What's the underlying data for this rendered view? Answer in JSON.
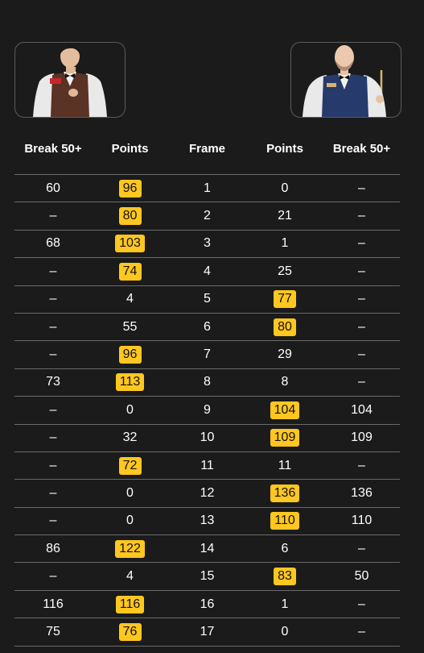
{
  "players": {
    "left": {
      "avatar": "player-left-photo",
      "logo_text": ""
    },
    "right": {
      "avatar": "player-right-photo"
    }
  },
  "headers": {
    "left_break": "Break 50+",
    "left_points": "Points",
    "frame": "Frame",
    "right_points": "Points",
    "right_break": "Break 50+"
  },
  "colors": {
    "background": "#1b1b1b",
    "winner_highlight": "#ffc71f",
    "divider": "#6a6a6a"
  },
  "frames": [
    {
      "left_break": "60",
      "left_points": "96",
      "frame": "1",
      "right_points": "0",
      "right_break": "–",
      "winner": "left"
    },
    {
      "left_break": "–",
      "left_points": "80",
      "frame": "2",
      "right_points": "21",
      "right_break": "–",
      "winner": "left"
    },
    {
      "left_break": "68",
      "left_points": "103",
      "frame": "3",
      "right_points": "1",
      "right_break": "–",
      "winner": "left"
    },
    {
      "left_break": "–",
      "left_points": "74",
      "frame": "4",
      "right_points": "25",
      "right_break": "–",
      "winner": "left"
    },
    {
      "left_break": "–",
      "left_points": "4",
      "frame": "5",
      "right_points": "77",
      "right_break": "–",
      "winner": "right"
    },
    {
      "left_break": "–",
      "left_points": "55",
      "frame": "6",
      "right_points": "80",
      "right_break": "–",
      "winner": "right"
    },
    {
      "left_break": "–",
      "left_points": "96",
      "frame": "7",
      "right_points": "29",
      "right_break": "–",
      "winner": "left"
    },
    {
      "left_break": "73",
      "left_points": "113",
      "frame": "8",
      "right_points": "8",
      "right_break": "–",
      "winner": "left"
    },
    {
      "left_break": "–",
      "left_points": "0",
      "frame": "9",
      "right_points": "104",
      "right_break": "104",
      "winner": "right"
    },
    {
      "left_break": "–",
      "left_points": "32",
      "frame": "10",
      "right_points": "109",
      "right_break": "109",
      "winner": "right"
    },
    {
      "left_break": "–",
      "left_points": "72",
      "frame": "11",
      "right_points": "11",
      "right_break": "–",
      "winner": "left"
    },
    {
      "left_break": "–",
      "left_points": "0",
      "frame": "12",
      "right_points": "136",
      "right_break": "136",
      "winner": "right"
    },
    {
      "left_break": "–",
      "left_points": "0",
      "frame": "13",
      "right_points": "110",
      "right_break": "110",
      "winner": "right"
    },
    {
      "left_break": "86",
      "left_points": "122",
      "frame": "14",
      "right_points": "6",
      "right_break": "–",
      "winner": "left"
    },
    {
      "left_break": "–",
      "left_points": "4",
      "frame": "15",
      "right_points": "83",
      "right_break": "50",
      "winner": "right"
    },
    {
      "left_break": "116",
      "left_points": "116",
      "frame": "16",
      "right_points": "1",
      "right_break": "–",
      "winner": "left"
    },
    {
      "left_break": "75",
      "left_points": "76",
      "frame": "17",
      "right_points": "0",
      "right_break": "–",
      "winner": "left"
    }
  ]
}
